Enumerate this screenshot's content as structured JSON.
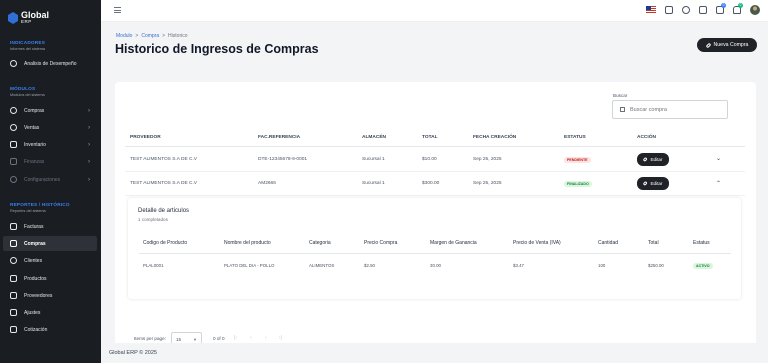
{
  "app": {
    "logo_name": "Global",
    "logo_sub": "ERP"
  },
  "sidebar": {
    "indicadores": {
      "title": "INDICADORES",
      "subtitle": "Informes del sistema"
    },
    "analisis": "Analisis de Desempeño",
    "modulos": {
      "title": "MÓDULOS",
      "subtitle": "Modulos del sistema"
    },
    "compras": "Compras",
    "ventas": "Ventas",
    "inventario": "Inventario",
    "finanzas": "Finanzas",
    "configuraciones": "Configuraciones",
    "reportes": {
      "title": "REPORTES / HISTÓRICO",
      "subtitle": "Reportes del sistema"
    },
    "facturas": "Facturas",
    "compras_hist": "Compras",
    "clientes": "Clientes",
    "productos": "Productos",
    "proveedores": "Proveedores",
    "ajustes": "Ajustes",
    "cotizacion": "Cotización"
  },
  "topbar": {
    "badge_a": "0",
    "badge_b": "0"
  },
  "breadcrumb": {
    "a": "Modulo",
    "sep": ">",
    "b": "Compra",
    "c": "Historico"
  },
  "page_title": "Historico de Ingresos de Compras",
  "new_button": "Nueva Compra",
  "search": {
    "label": "Buscar",
    "placeholder": "Buscar compra"
  },
  "table": {
    "headers": {
      "proveedor": "PROVEEDOR",
      "fac": "FAC.REFERENCIA",
      "almacen": "ALMACÉN",
      "total": "TOTAL",
      "fecha": "FECHA CREACIÓN",
      "estatus": "ESTATUS",
      "accion": "ACCIÓN"
    },
    "rows": [
      {
        "proveedor": "TEST ALIMENTOS S.A DE C.V",
        "fac": "DTE-12345678-9-0001",
        "almacen": "Sucursal 1",
        "total": "$10.00",
        "fecha": "Sep 25, 2025",
        "estatus": "PENDIENTE",
        "accion": "Editar"
      },
      {
        "proveedor": "TEST ALIMENTOS S.A DE C.V",
        "fac": "AM2666",
        "almacen": "Sucursal 1",
        "total": "$300.00",
        "fecha": "Sep 25, 2025",
        "estatus": "FINALIZADO",
        "accion": "Editar"
      }
    ]
  },
  "detail": {
    "title": "Detalle de articulos",
    "subtitle": "1 completados",
    "headers": {
      "codigo": "Codigo de Producto",
      "nombre": "Nombre del producto",
      "categoria": "Categoria",
      "precio": "Precio Compra",
      "margen": "Margen de Ganancia",
      "venta": "Precio de Venta (IVA)",
      "cantidad": "Cantidad",
      "total": "Total",
      "estatus": "Estatus"
    },
    "row": {
      "codigo": "PLAL0001",
      "nombre": "PLATO DEL DIA - POLLO",
      "categoria": "ALIMENTOS",
      "precio": "$2.50",
      "margen": "30.00",
      "venta": "$3.47",
      "cantidad": "100",
      "total": "$250.00",
      "estatus": "ACTIVO"
    }
  },
  "pagination": {
    "label": "Items per page:",
    "size": "15",
    "range": "0 of 0"
  },
  "footer": "Global ERP © 2025",
  "colors": {
    "sidebar": "#1a1d21",
    "accent": "#3b82f6",
    "button": "#1f2328"
  }
}
